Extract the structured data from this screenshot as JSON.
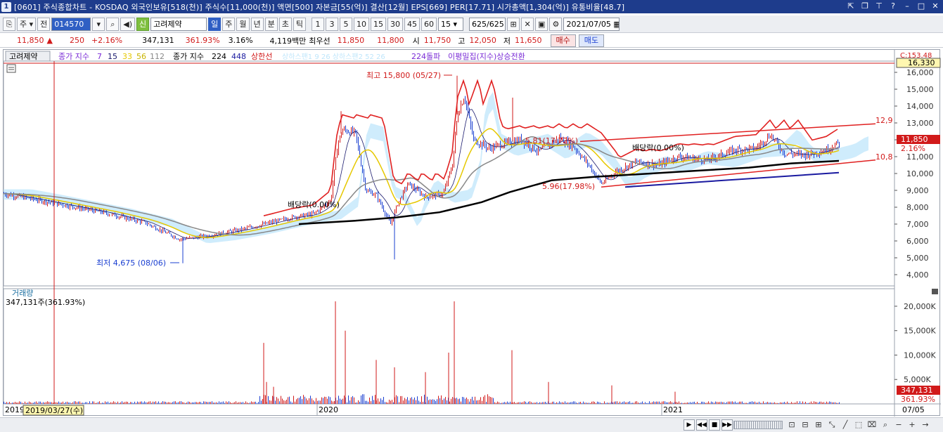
{
  "title_bar": {
    "app_icon": "1",
    "title": "[0601] 주식종합차트 - KOSDAQ 외국인보유[518(천)] 주식수[11,000(천)] 액면[500] 자본금[55(억)] 결산[12월] EPS[669] PER[17.71] 시가총액[1,304(억)] 유통비율[48.7]"
  },
  "toolbar": {
    "type_select": "주",
    "prev_label": "전",
    "code": "014570",
    "new_label": "신",
    "stock_name": "고려제약",
    "period_tabs": [
      {
        "label": "일",
        "active": true
      },
      {
        "label": "주",
        "active": false
      },
      {
        "label": "월",
        "active": false
      },
      {
        "label": "년",
        "active": false
      },
      {
        "label": "분",
        "active": false
      },
      {
        "label": "초",
        "active": false
      },
      {
        "label": "틱",
        "active": false
      }
    ],
    "intervals": [
      "1",
      "3",
      "5",
      "10",
      "15",
      "30",
      "45",
      "60"
    ],
    "interval_select": "15",
    "count_label": "625",
    "count_total": "/625",
    "date": "2021/07/05"
  },
  "quote": {
    "price": "11,850",
    "change": "250",
    "change_pct": "+2.16%",
    "volume": "347,131",
    "volume_pct": "361.93%",
    "turnover": "3.16%",
    "amount": "4,119백만",
    "best_ask_label": "최우선",
    "best_ask": "11,850",
    "best_bid": "11,800",
    "open_label": "시",
    "open": "11,750",
    "high_label": "고",
    "high": "12,050",
    "low_label": "저",
    "low": "11,650",
    "buy_label": "매수",
    "sell_label": "매도"
  },
  "chart": {
    "legend_name": "고려제약",
    "legend_ma_prefix": "종가 지수",
    "legend_ma": [
      {
        "label": "7",
        "color": "#7a2bd6"
      },
      {
        "label": "15",
        "color": "#1a1a6e"
      },
      {
        "label": "33",
        "color": "#e6c800"
      },
      {
        "label": "56",
        "color": "#c8b400"
      },
      {
        "label": "112",
        "color": "#888888"
      }
    ],
    "legend_ma2_prefix": "종가 지수",
    "legend_ma2": [
      {
        "label": "224",
        "color": "#000000"
      },
      {
        "label": "448",
        "color": "#1a1aa0"
      }
    ],
    "legend_upper": "상한선",
    "legend_faded": "상하스팬1 9 26  상하스팬2 52 26",
    "legend_224": "224돌파",
    "legend_dense": "이평밀집(지수)상승전환",
    "y_labels": [
      "16,000",
      "15,000",
      "14,000",
      "13,000",
      "12,000",
      "11,000",
      "10,000",
      "9,000",
      "8,000",
      "7,000",
      "6,000",
      "5,000",
      "4,000"
    ],
    "y_top_label": "C:153.48",
    "y_cursor_label": "16,330",
    "price_badge": "11,850",
    "price_badge_pct": "2.16%",
    "annotations": {
      "high": "최고 15,800 (05/27)",
      "low": "최저 4,675 (08/06)",
      "dividend1": "배당락(0.00%)",
      "dividend2": "배당락(0.00%)",
      "upper_channel": "12,9",
      "lower_channel": "10,8",
      "pct_upper": "5.81(17.72%)",
      "pct_lower": "5.96(17.98%)"
    },
    "volume_title": "거래량",
    "volume_value": "347,131주(361.93%)",
    "vol_labels": [
      "20,000K",
      "15,000K",
      "10,000K",
      "5,000K"
    ],
    "vol_badge": "347,131",
    "vol_badge_pct": "361.93%",
    "x_labels": [
      "2019",
      "2020",
      "2021"
    ],
    "x_cursor_label": "2019/03/27(수)",
    "x_right_label": "07/05",
    "colors": {
      "up": "#d11a1a",
      "down": "#1a3fd1",
      "cloud": "#bfe6fb",
      "channel": "#e02020"
    }
  },
  "icons": [
    "chart-menu-icon",
    "search-icon",
    "speaker-icon",
    "chart-type-icon",
    "save-icon",
    "gear-icon",
    "calendar-icon"
  ]
}
